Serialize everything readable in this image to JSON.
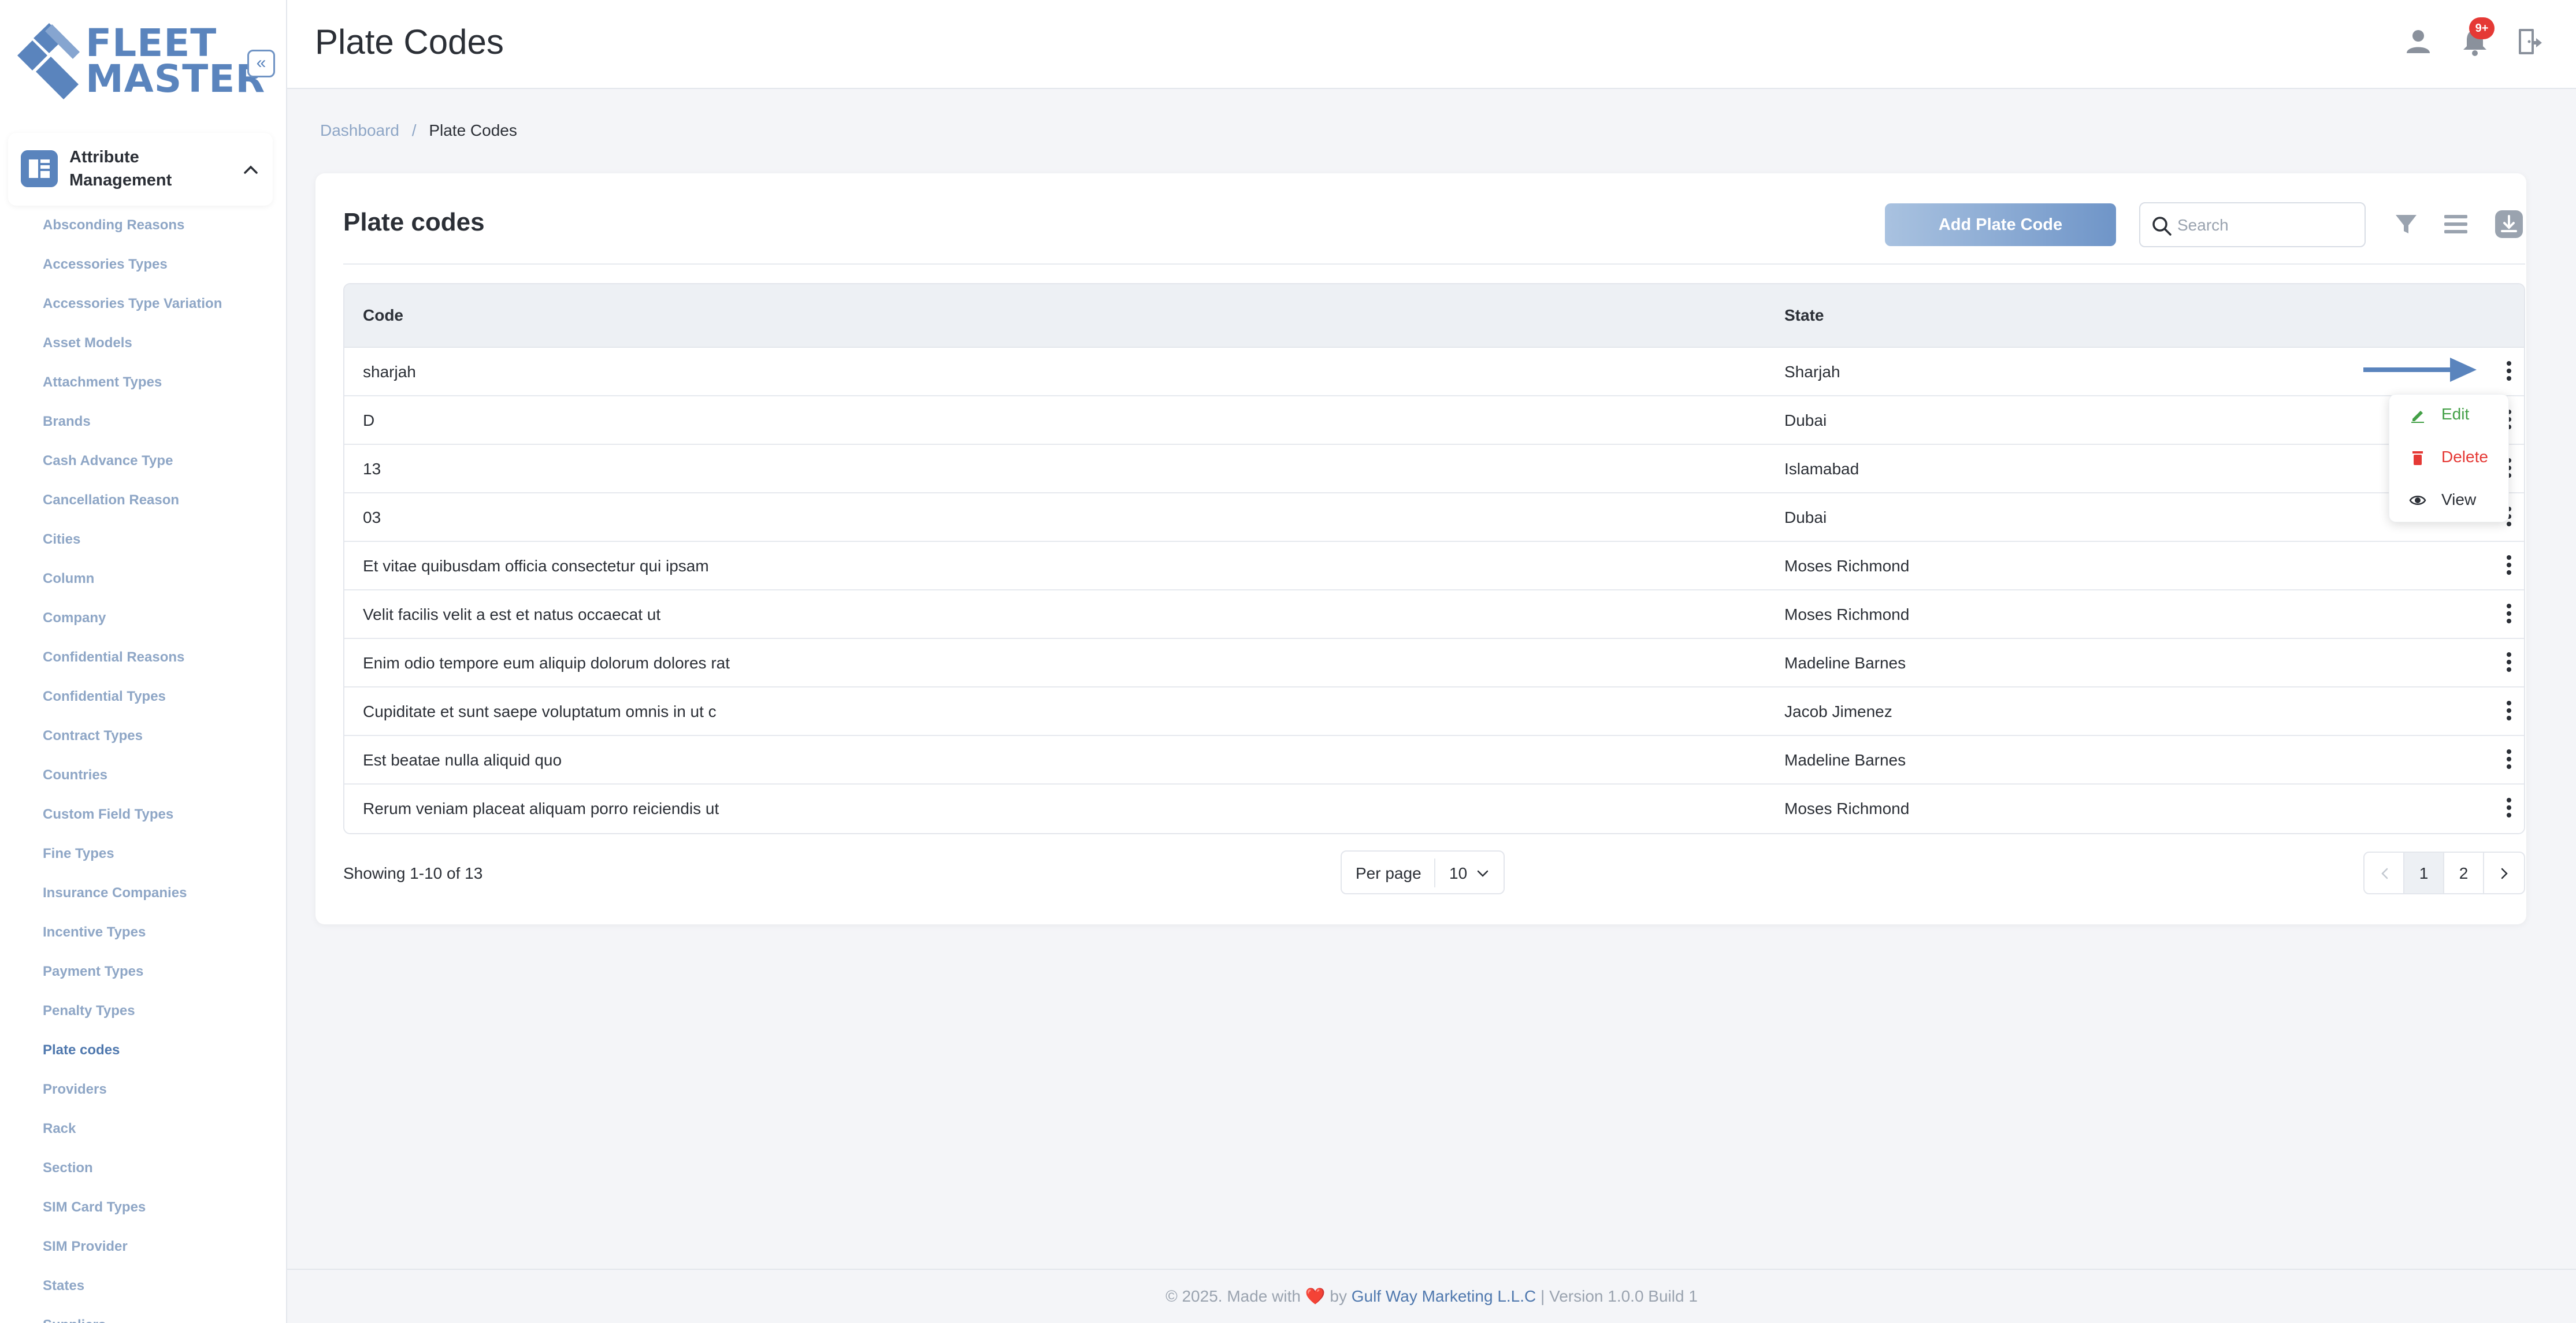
{
  "app": {
    "logo_line1": "FLEET",
    "logo_line2": "MASTER",
    "brand_color": "#5a84bd"
  },
  "sidebar": {
    "group_title": "Attribute Management",
    "items": [
      {
        "label": "Absconding Reasons"
      },
      {
        "label": "Accessories Types"
      },
      {
        "label": "Accessories Type Variation"
      },
      {
        "label": "Asset Models"
      },
      {
        "label": "Attachment Types"
      },
      {
        "label": "Brands"
      },
      {
        "label": "Cash Advance Type"
      },
      {
        "label": "Cancellation Reason"
      },
      {
        "label": "Cities"
      },
      {
        "label": "Column"
      },
      {
        "label": "Company"
      },
      {
        "label": "Confidential Reasons"
      },
      {
        "label": "Confidential Types"
      },
      {
        "label": "Contract Types"
      },
      {
        "label": "Countries"
      },
      {
        "label": "Custom Field Types"
      },
      {
        "label": "Fine Types"
      },
      {
        "label": "Insurance Companies"
      },
      {
        "label": "Incentive Types"
      },
      {
        "label": "Payment Types"
      },
      {
        "label": "Penalty Types"
      },
      {
        "label": "Plate codes",
        "active": true
      },
      {
        "label": "Providers"
      },
      {
        "label": "Rack"
      },
      {
        "label": "Section"
      },
      {
        "label": "SIM Card Types"
      },
      {
        "label": "SIM Provider"
      },
      {
        "label": "States"
      },
      {
        "label": "Suppliers"
      }
    ]
  },
  "header": {
    "title": "Plate Codes",
    "notification_badge": "9+",
    "icons": [
      "user-icon",
      "bell-icon",
      "logout-icon"
    ]
  },
  "breadcrumb": {
    "home": "Dashboard",
    "separator": "/",
    "current": "Plate Codes"
  },
  "card": {
    "title": "Plate codes",
    "add_button": "Add Plate Code",
    "search_placeholder": "Search"
  },
  "table": {
    "columns": [
      "Code",
      "State"
    ],
    "rows": [
      {
        "code": "sharjah",
        "state": "Sharjah"
      },
      {
        "code": "D",
        "state": "Dubai"
      },
      {
        "code": "13",
        "state": "Islamabad"
      },
      {
        "code": "03",
        "state": "Dubai"
      },
      {
        "code": "Et vitae quibusdam officia consectetur qui ipsam",
        "state": "Moses Richmond"
      },
      {
        "code": "Velit facilis velit a est et natus occaecat ut",
        "state": "Moses Richmond"
      },
      {
        "code": "Enim odio tempore eum aliquip dolorum dolores rat",
        "state": "Madeline Barnes"
      },
      {
        "code": "Cupiditate et sunt saepe voluptatum omnis in ut c",
        "state": "Jacob Jimenez"
      },
      {
        "code": "Est beatae nulla aliquid quo",
        "state": "Madeline Barnes"
      },
      {
        "code": "Rerum veniam placeat aliquam porro reiciendis ut",
        "state": "Moses Richmond"
      }
    ]
  },
  "row_menu": {
    "edit": "Edit",
    "delete": "Delete",
    "view": "View",
    "edit_color": "#43a047",
    "delete_color": "#e53935"
  },
  "pagination": {
    "showing": "Showing 1-10 of 13",
    "per_page_label": "Per page",
    "per_page_value": "10",
    "pages": [
      "1",
      "2"
    ],
    "current_page": "1"
  },
  "footer": {
    "prefix": "© 2025. Made with",
    "heart": "❤️",
    "by": "by",
    "company": "Gulf Way Marketing L.L.C",
    "suffix": "| Version 1.0.0 Build 1"
  }
}
